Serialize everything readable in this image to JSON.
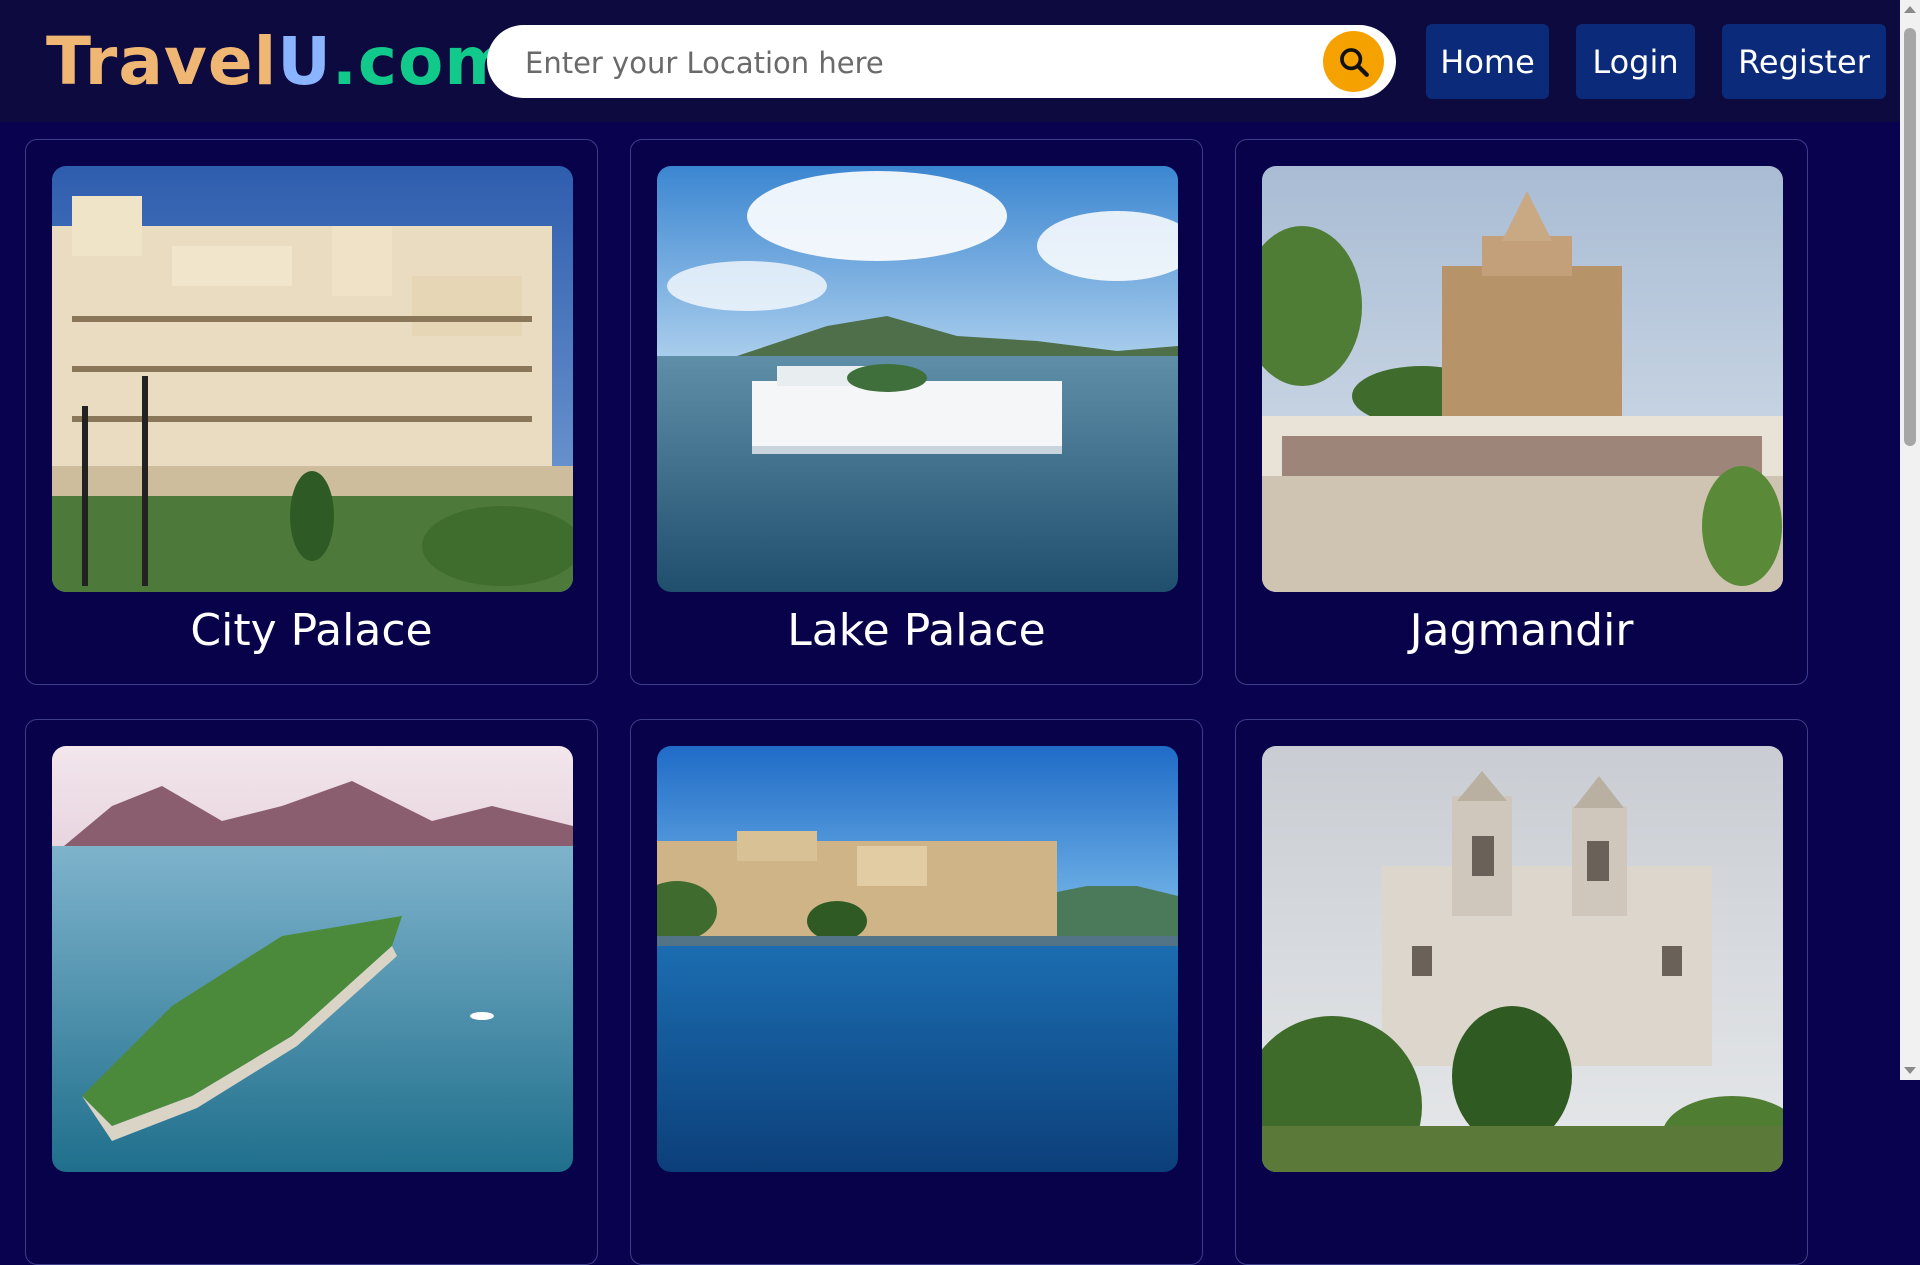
{
  "header": {
    "logo": {
      "part1": "Travel",
      "part2": "U",
      "part3": ".com"
    },
    "search": {
      "placeholder": "Enter your Location here"
    },
    "nav": [
      {
        "label": "Home"
      },
      {
        "label": "Login"
      },
      {
        "label": "Register"
      }
    ]
  },
  "places": [
    {
      "title": "City Palace"
    },
    {
      "title": "Lake Palace"
    },
    {
      "title": "Jagmandir"
    },
    {
      "title": ""
    },
    {
      "title": ""
    },
    {
      "title": ""
    }
  ],
  "colors": {
    "background": "#08024f",
    "header": "#0c0a3e",
    "nav_button": "#0b2a7a",
    "search_button": "#f5a100",
    "logo_travel": "#f0b673",
    "logo_u": "#8ab4ff",
    "logo_com": "#10c98a"
  },
  "icons": {
    "search_button": "search-icon"
  }
}
